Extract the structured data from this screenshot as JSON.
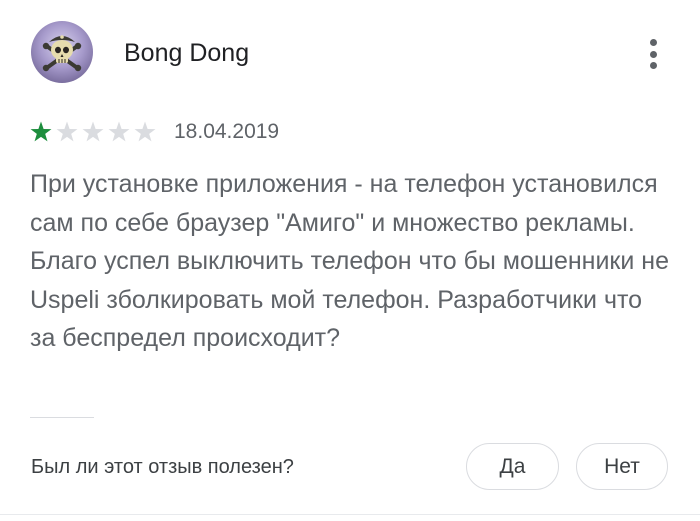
{
  "review": {
    "author_name": "Bong Dong",
    "avatar_icon": "skull-crossbones-avatar",
    "more_icon": "more-vert-icon",
    "rating": 1,
    "rating_max": 5,
    "star_filled_color": "#1e8e3e",
    "star_empty_color": "#dadce0",
    "date": "18.04.2019",
    "text": "При установке приложения - на телефон установился сам по себе браузер \"Амиго\" и множество рекламы. Благо успел выключить телефон что бы мошенники не Uspeli зболкировать мой телефон. Разработчики что за беспредел происходит?"
  },
  "helpful": {
    "question": "Был ли этот отзыв полезен?",
    "yes_label": "Да",
    "no_label": "Нет"
  }
}
